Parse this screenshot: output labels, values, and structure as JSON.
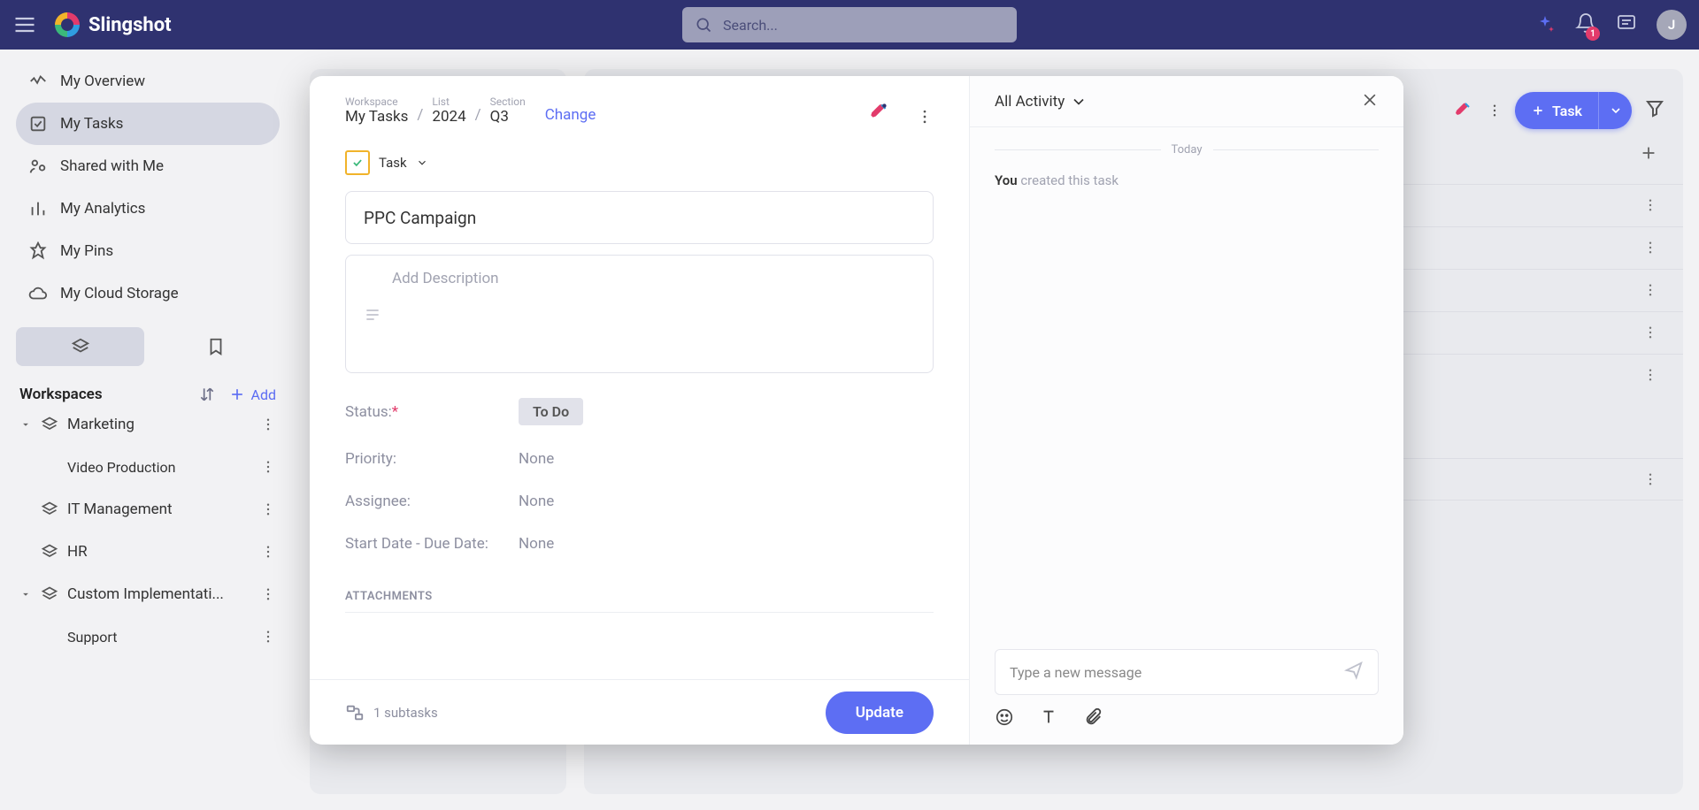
{
  "app_name": "Slingshot",
  "search_placeholder": "Search...",
  "notification_count": "1",
  "avatar_initial": "J",
  "nav": {
    "overview": "My Overview",
    "tasks": "My Tasks",
    "shared": "Shared with Me",
    "analytics": "My Analytics",
    "pins": "My Pins",
    "cloud": "My Cloud Storage"
  },
  "workspaces_label": "Workspaces",
  "add_label": "Add",
  "workspaces": {
    "marketing": "Marketing",
    "video_production": "Video Production",
    "it_management": "IT Management",
    "hr": "HR",
    "custom_impl": "Custom Implementati...",
    "support": "Support"
  },
  "bg_task_button": "Task",
  "modal": {
    "crumb": {
      "workspace_label": "Workspace",
      "workspace_val": "My Tasks",
      "list_label": "List",
      "list_val": "2024",
      "section_label": "Section",
      "section_val": "Q3",
      "change": "Change"
    },
    "type_label": "Task",
    "title": "PPC Campaign",
    "desc_placeholder": "Add Description",
    "status_label": "Status:",
    "status_value": "To Do",
    "priority_label": "Priority:",
    "priority_value": "None",
    "assignee_label": "Assignee:",
    "assignee_value": "None",
    "dates_label": "Start Date - Due Date:",
    "dates_value": "None",
    "attachments_label": "ATTACHMENTS",
    "subtasks": "1 subtasks",
    "update": "Update",
    "activity_title": "All Activity",
    "today": "Today",
    "activity_you": "You",
    "activity_text": " created this task",
    "compose_placeholder": "Type a new message"
  }
}
